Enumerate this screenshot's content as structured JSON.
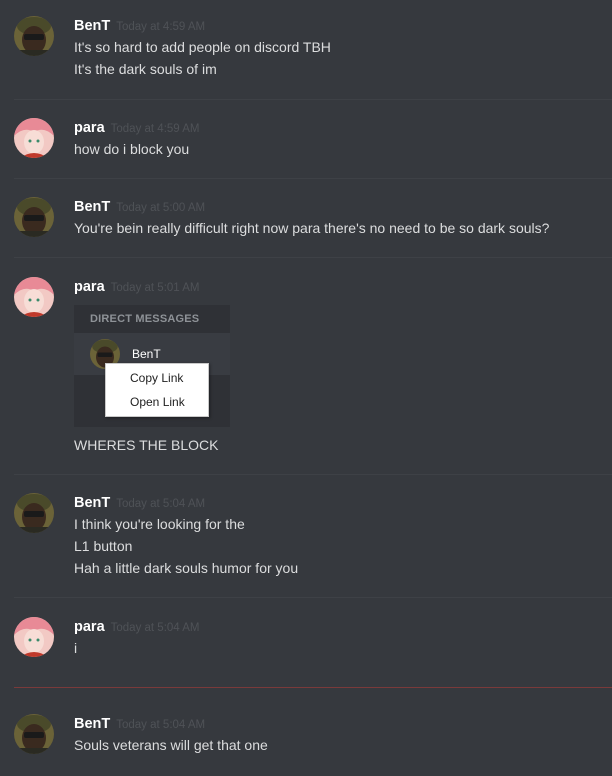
{
  "messages": [
    {
      "author": "BenT",
      "timestamp": "Today at 4:59 AM",
      "avatar": "bent-avatar",
      "lines": [
        "It's so hard to add people on discord TBH",
        "It's the dark souls of im"
      ]
    },
    {
      "author": "para",
      "timestamp": "Today at 4:59 AM",
      "avatar": "para-avatar",
      "lines": [
        "how do i block you"
      ]
    },
    {
      "author": "BenT",
      "timestamp": "Today at 5:00 AM",
      "avatar": "bent-avatar",
      "lines": [
        "You're bein really difficult right now para there's no need to be so dark souls?"
      ]
    },
    {
      "author": "para",
      "timestamp": "Today at 5:01 AM",
      "avatar": "para-avatar",
      "lines": [
        "WHERES THE BLOCK"
      ]
    },
    {
      "author": "BenT",
      "timestamp": "Today at 5:04 AM",
      "avatar": "bent-avatar",
      "lines": [
        "I think you're looking for the",
        "L1 button",
        "Hah a little dark souls humor for you"
      ]
    },
    {
      "author": "para",
      "timestamp": "Today at 5:04 AM",
      "avatar": "para-avatar",
      "lines": [
        "i"
      ]
    },
    {
      "author": "BenT",
      "timestamp": "Today at 5:04 AM",
      "avatar": "bent-avatar",
      "lines": [
        "Souls veterans will get that one"
      ]
    }
  ],
  "embed": {
    "section_title": "DIRECT MESSAGES",
    "dm_user": "BenT",
    "context_menu": [
      "Copy Link",
      "Open Link"
    ]
  },
  "colors": {
    "background": "#36393e",
    "username": "#ffffff",
    "timestamp": "#4f5257",
    "message_text": "#dcddde",
    "new_messages_divider": "#7a3a3a"
  }
}
